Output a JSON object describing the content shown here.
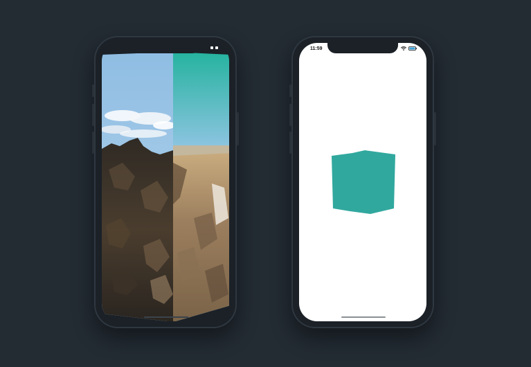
{
  "page": {
    "background": "#232b33"
  },
  "left_phone": {
    "screen_content": "cube-transition-photo",
    "face_colors": {
      "sky": "#9cc4e4",
      "sky_teal": "#2fb3a4",
      "mountain_dark": "#3a3128",
      "mountain_light": "#9c7f5e",
      "desert": "#b8996d"
    }
  },
  "right_phone": {
    "status": {
      "time": "11:59",
      "wifi_icon": "wifi-icon",
      "battery_icon": "battery-icon"
    },
    "cube_color": "#31a89e"
  }
}
